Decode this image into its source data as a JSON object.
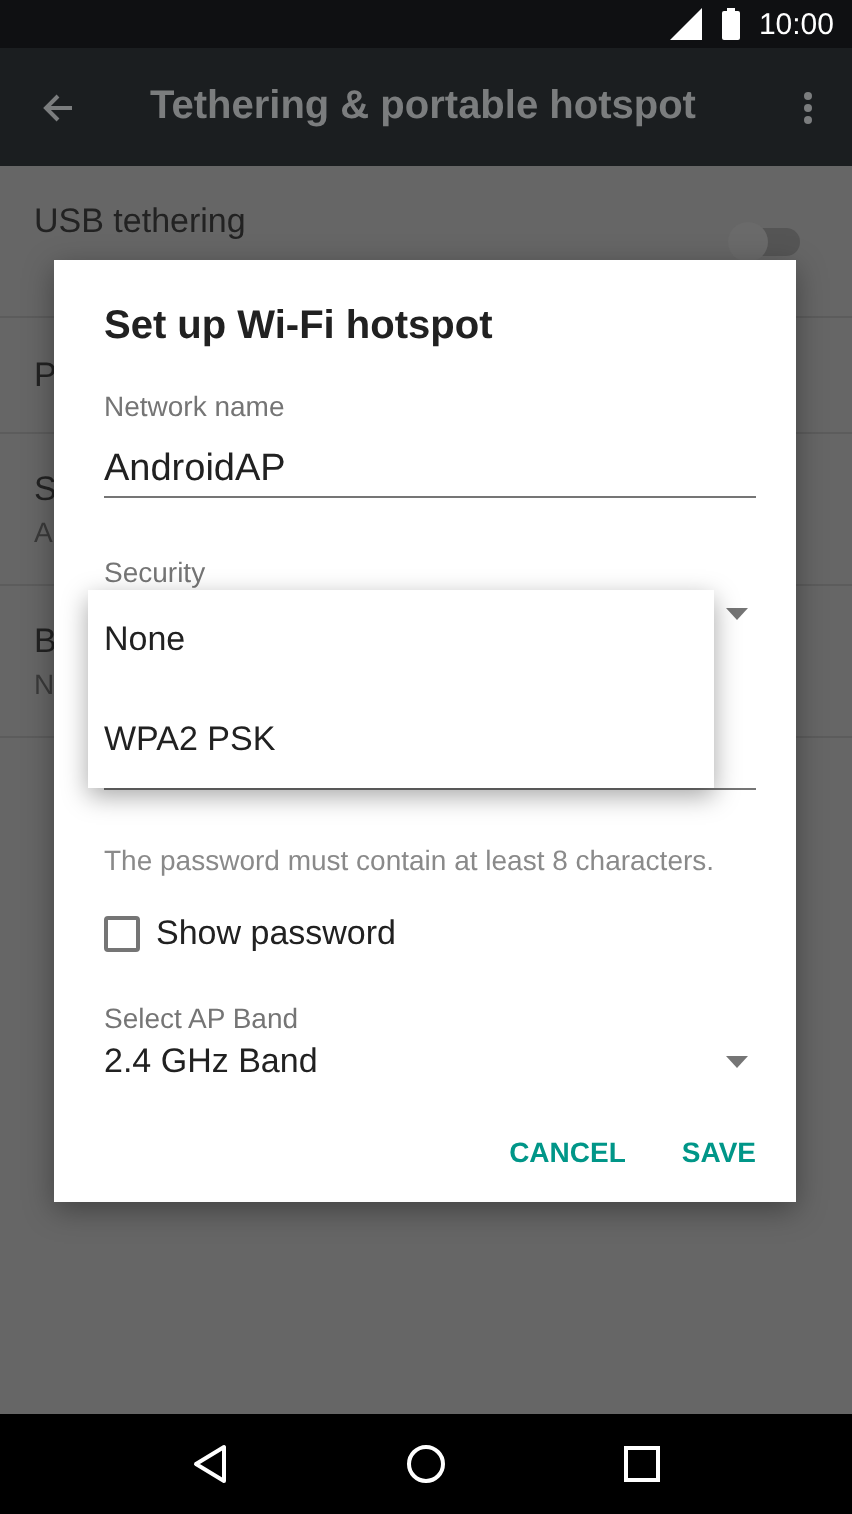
{
  "status_bar": {
    "time": "10:00"
  },
  "app_bar": {
    "title": "Tethering & portable hotspot"
  },
  "settings": [
    {
      "title": "USB tethering",
      "kind": "switch",
      "on": false
    },
    {
      "title": "P",
      "kind": "plain"
    },
    {
      "title": "S",
      "subtitle": "A",
      "kind": "plain"
    },
    {
      "title": "B",
      "subtitle": "N",
      "kind": "plain"
    }
  ],
  "dialog": {
    "title": "Set up Wi-Fi hotspot",
    "network_name": {
      "label": "Network name",
      "value": "AndroidAP"
    },
    "security": {
      "label": "Security",
      "options": [
        "None",
        "WPA2 PSK"
      ]
    },
    "password_hint": "The password must contain at least 8 characters.",
    "show_password": {
      "label": "Show password",
      "checked": false
    },
    "ap_band": {
      "label": "Select AP Band",
      "value": "2.4 GHz Band"
    },
    "buttons": [
      "CANCEL",
      "SAVE"
    ]
  }
}
